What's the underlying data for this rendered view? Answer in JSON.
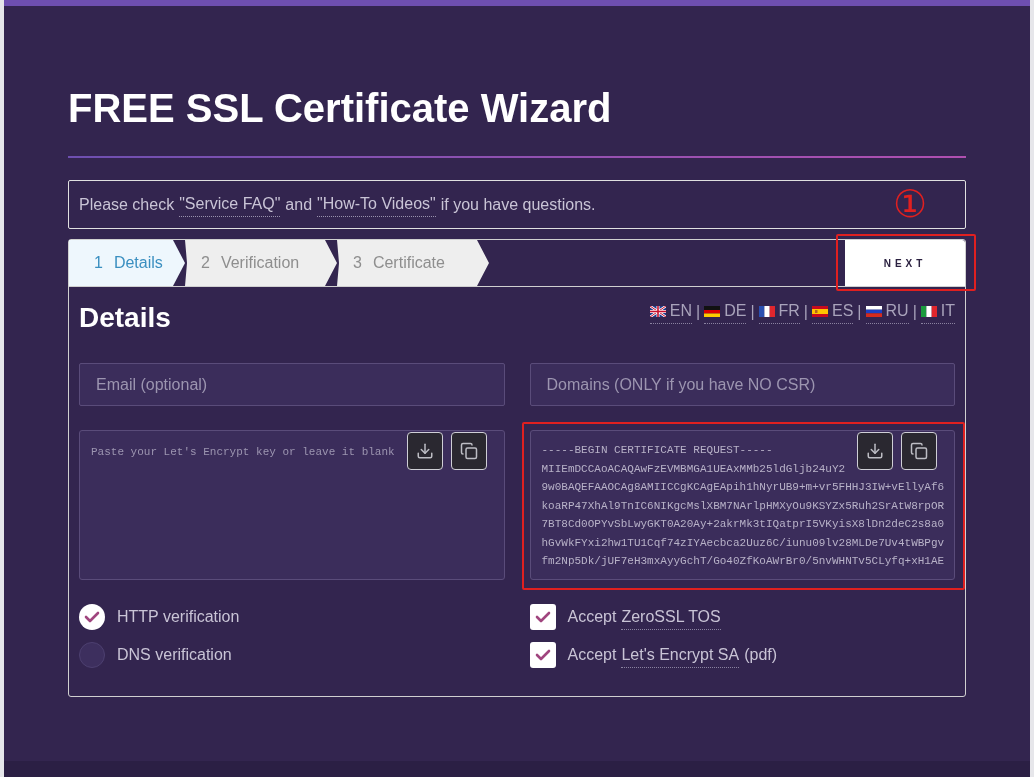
{
  "title": "FREE SSL Certificate Wizard",
  "notice": [
    {
      "kind": "text",
      "text": "Please check"
    },
    {
      "kind": "link",
      "text": "\"Service FAQ\""
    },
    {
      "kind": "text",
      "text": "and"
    },
    {
      "kind": "link",
      "text": "\"How-To Videos\""
    },
    {
      "kind": "text",
      "text": "if you have questions."
    }
  ],
  "steps": [
    {
      "number": "1",
      "label": "Details",
      "selected": true
    },
    {
      "number": "2",
      "label": "Verification",
      "selected": false
    },
    {
      "number": "3",
      "label": "Certificate",
      "selected": false
    }
  ],
  "next_button": {
    "label": "NEXT",
    "highlighted": true
  },
  "annotation": "①",
  "section_title": "Details",
  "languages": [
    {
      "code": "EN",
      "kind": "uk"
    },
    {
      "code": "DE",
      "kind": "de"
    },
    {
      "code": "FR",
      "kind": "fr"
    },
    {
      "code": "ES",
      "kind": "es"
    },
    {
      "code": "RU",
      "kind": "ru"
    },
    {
      "code": "IT",
      "kind": "it"
    }
  ],
  "language_separator": "|",
  "email_field": {
    "placeholder": "Email (optional)"
  },
  "domains_field": {
    "placeholder": "Domains (ONLY if you have NO CSR)"
  },
  "key_box": {
    "placeholder": "Paste your Let's Encrypt key or leave it blank"
  },
  "csr_box": {
    "highlighted": true,
    "lines": [
      "-----BEGIN CERTIFICATE REQUEST-----",
      "MIIEmDCCAoACAQAwFzEVMBMGA1UEAxMMb25ldGljb24uY2",
      "9w0BAQEFAAOCAg8AMIICCgKCAgEApih1hNyrUB9+m+vr5FHHJ3IW+vEllyAf6",
      "koaRP47XhAl9TnIC6NIKgcMslXBM7NArlpHMXyOu9KSYZx5Ruh2SrAtW8rpOR",
      "7BT8Cd0OPYvSbLwyGKT0A20Ay+2akrMk3tIQatprI5VKyisX8lDn2deC2s8a0",
      "hGvWkFYxi2hw1TU1Cqf74zIYAecbca2Uuz6C/iunu09lv28MLDe7Uv4tWBPgv",
      "fm2Np5Dk/jUF7eH3mxAyyGchT/Go40ZfKoAWrBr0/5nvWHNTv5CLyfq+xH1AE"
    ]
  },
  "verification": [
    {
      "label": "HTTP verification",
      "selected": true
    },
    {
      "label": "DNS verification",
      "selected": false
    }
  ],
  "agreements": [
    {
      "prefix": "Accept",
      "link": "ZeroSSL TOS",
      "checked": true
    },
    {
      "prefix": "Accept",
      "link": "Let's Encrypt SA",
      "suffix": "(pdf)",
      "checked": true
    }
  ]
}
